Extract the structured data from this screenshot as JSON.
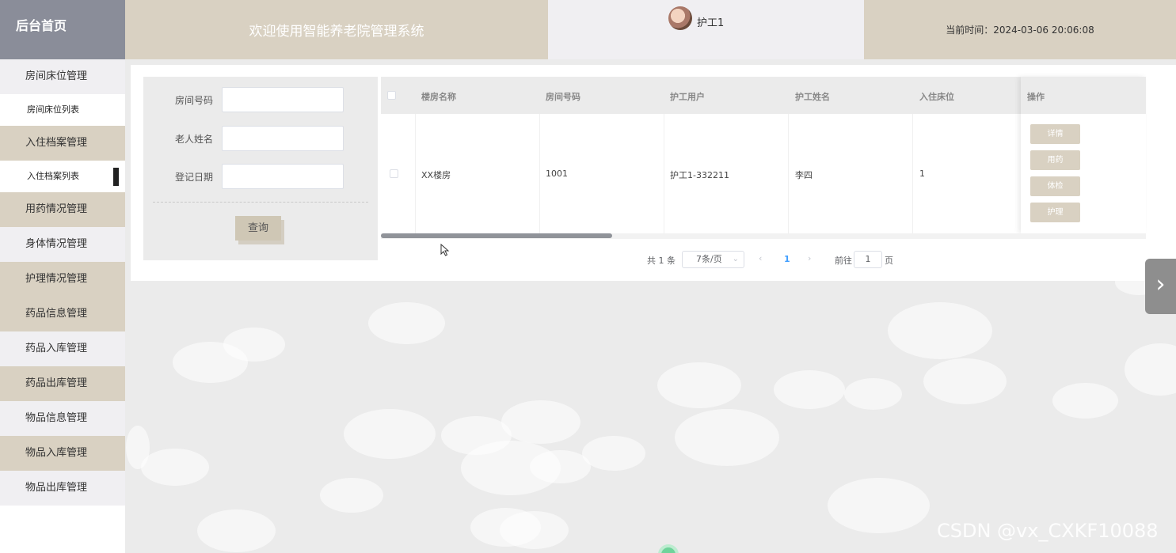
{
  "header": {
    "logo": "后台首页",
    "title": "欢迎使用智能养老院管理系统",
    "username": "护工1",
    "time_label": "当前时间：2024-03-06 20:06:08"
  },
  "sidebar": {
    "items": [
      {
        "label": "房间床位管理"
      },
      {
        "label": "房间床位列表"
      },
      {
        "label": "入住档案管理"
      },
      {
        "label": "入住档案列表"
      },
      {
        "label": "用药情况管理"
      },
      {
        "label": "身体情况管理"
      },
      {
        "label": "护理情况管理"
      },
      {
        "label": "药品信息管理"
      },
      {
        "label": "药品入库管理"
      },
      {
        "label": "药品出库管理"
      },
      {
        "label": "物品信息管理"
      },
      {
        "label": "物品入库管理"
      },
      {
        "label": "物品出库管理"
      }
    ]
  },
  "search": {
    "room_no_label": "房间号码",
    "room_no_value": "",
    "elder_name_label": "老人姓名",
    "elder_name_value": "",
    "reg_date_label": "登记日期",
    "reg_date_value": "",
    "query_button": "查询"
  },
  "table": {
    "columns": [
      "楼房名称",
      "房间号码",
      "护工用户",
      "护工姓名",
      "入住床位",
      "操作"
    ],
    "rows": [
      {
        "building": "XX楼房",
        "room": "1001",
        "nurse_user": "护工1-332211",
        "nurse_name": "李四",
        "bed": "1"
      }
    ],
    "actions": [
      "详情",
      "用药",
      "体检",
      "护理"
    ]
  },
  "pager": {
    "total": "共 1 条",
    "page_size": "7条/页",
    "current": "1",
    "goto_label": "前往",
    "goto_value": "1",
    "goto_unit": "页"
  },
  "watermark": "CSDN @vx_CXKF10088",
  "colors": {
    "beige": "#d9d1c2",
    "slate": "#8a8d99",
    "light": "#f0eff2",
    "link_blue": "#409eff"
  }
}
